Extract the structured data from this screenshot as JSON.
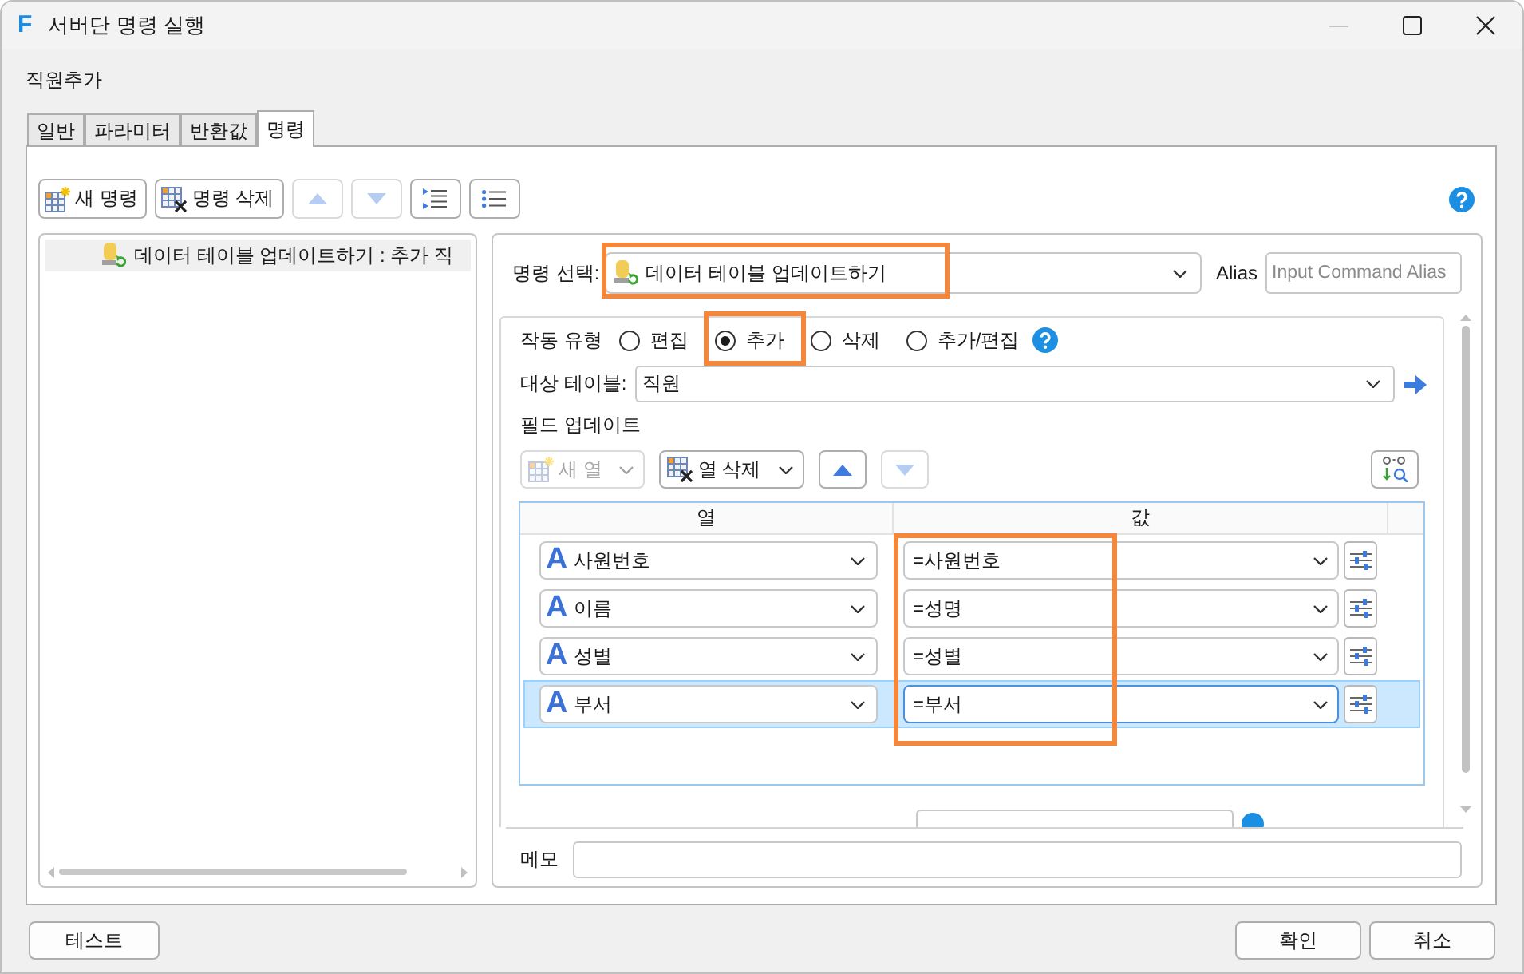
{
  "window": {
    "logo": "F",
    "title": "서버단 명령 실행"
  },
  "heading": "직원추가",
  "tabs": [
    {
      "label": "일반",
      "selected": false
    },
    {
      "label": "파라미터",
      "selected": false
    },
    {
      "label": "반환값",
      "selected": false
    },
    {
      "label": "명령",
      "selected": true
    }
  ],
  "command_toolbar": [
    {
      "kind": "add",
      "label": "새 명령",
      "disabled": false
    },
    {
      "kind": "remove",
      "label": "명령 삭제",
      "disabled": false
    },
    {
      "kind": "up",
      "disabled": true
    },
    {
      "kind": "down",
      "disabled": true
    },
    {
      "kind": "indent",
      "disabled": false
    },
    {
      "kind": "outdent",
      "disabled": false
    }
  ],
  "command_list": {
    "items": [
      {
        "label": "데이터 테이블 업데이트하기 : 추가 직",
        "selected": true
      }
    ]
  },
  "command_editor": {
    "select_label": "명령 선택:",
    "command": {
      "value": "데이터 테이블 업데이트하기",
      "highlighted": true
    },
    "alias_label": "Alias",
    "alias": {
      "placeholder": "Input Command Alias"
    },
    "action_type": {
      "label": "작동 유형",
      "options": [
        {
          "label": "편집",
          "selected": false,
          "highlighted": false
        },
        {
          "label": "추가",
          "selected": true,
          "highlighted": true
        },
        {
          "label": "삭제",
          "selected": false,
          "highlighted": false
        },
        {
          "label": "추가/편집",
          "selected": false,
          "highlighted": false
        }
      ]
    },
    "target_table": {
      "label": "대상 테이블:",
      "value": "직원"
    },
    "field_update": {
      "label": "필드 업데이트",
      "toolbar": [
        {
          "kind": "add",
          "label": "새 열",
          "disabled": true,
          "menu": true
        },
        {
          "kind": "remove",
          "label": "열 삭제",
          "disabled": false,
          "menu": true
        },
        {
          "kind": "up",
          "disabled": false,
          "menu": false
        },
        {
          "kind": "down",
          "disabled": true,
          "menu": false
        },
        {
          "kind": "map",
          "disabled": false,
          "menu": false
        }
      ],
      "columns": [
        {
          "label": "열",
          "highlighted": false
        },
        {
          "label": "값",
          "highlighted": true
        }
      ],
      "rows": [
        {
          "type": "A",
          "column": "사원번호",
          "value": "=사원번호",
          "selected": false
        },
        {
          "type": "A",
          "column": "이름",
          "value": "=성명",
          "selected": false
        },
        {
          "type": "A",
          "column": "성별",
          "value": "=성별",
          "selected": false
        },
        {
          "type": "A",
          "column": "부서",
          "value": "=부서",
          "selected": true
        }
      ]
    },
    "memo": {
      "label": "메모"
    }
  },
  "footer": {
    "test_button": "테스트",
    "buttons": [
      "확인",
      "취소"
    ]
  }
}
